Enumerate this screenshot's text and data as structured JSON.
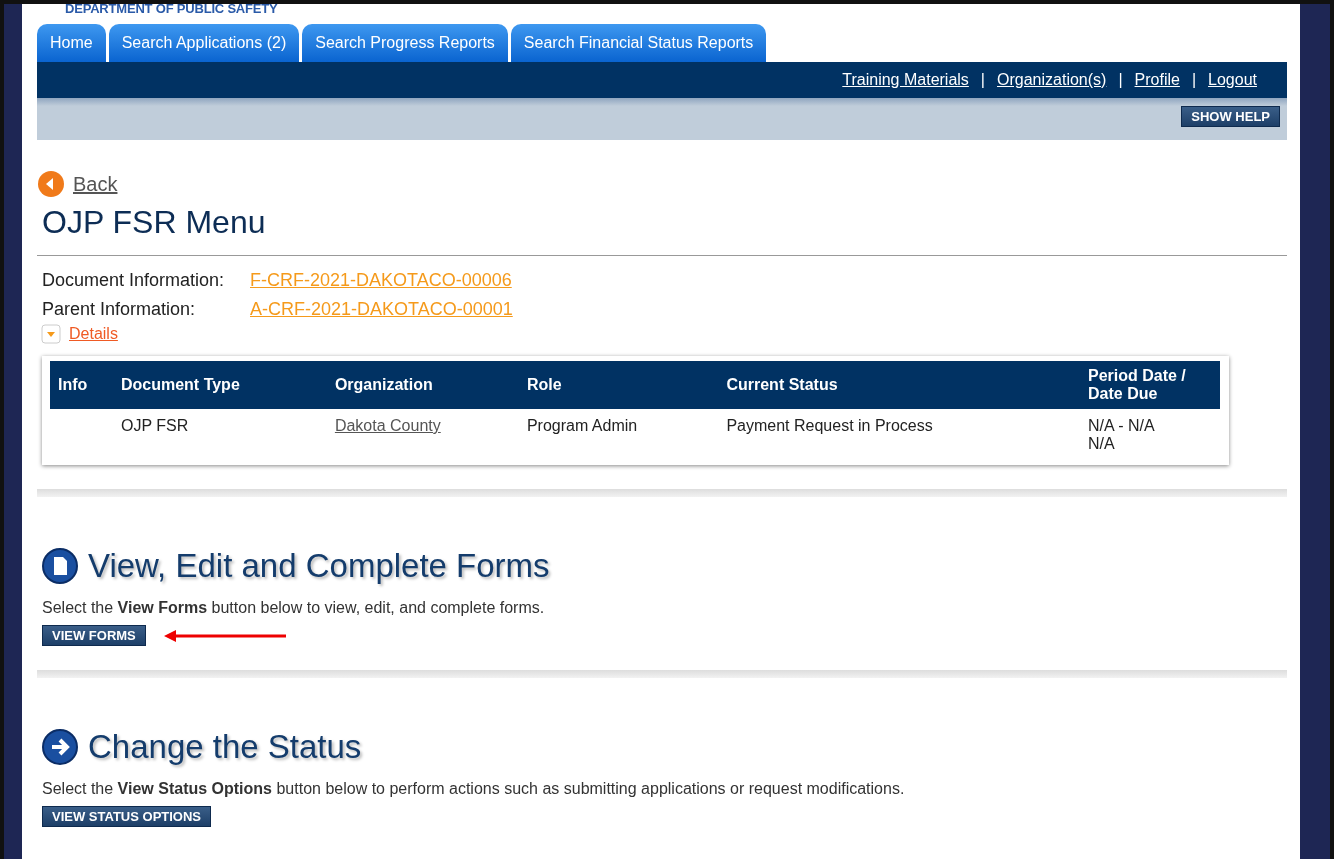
{
  "header": {
    "agency": "DEPARTMENT OF PUBLIC SAFETY"
  },
  "tabs": [
    {
      "label": "Home"
    },
    {
      "label": "Search Applications (2)"
    },
    {
      "label": "Search Progress Reports"
    },
    {
      "label": "Search Financial Status Reports"
    }
  ],
  "top_links": [
    "Training Materials",
    "Organization(s)",
    "Profile",
    "Logout"
  ],
  "link_separator": "|",
  "help_button": "SHOW HELP",
  "back": "Back",
  "page_title": "OJP FSR Menu",
  "info": [
    {
      "label": "Document Information:",
      "value": "F-CRF-2021-DAKOTACO-00006"
    },
    {
      "label": "Parent Information:",
      "value": "A-CRF-2021-DAKOTACO-00001"
    }
  ],
  "details_toggle": {
    "label": "Details",
    "expanded": false
  },
  "table": {
    "columns": [
      "Info",
      "Document Type",
      "Organization",
      "Role",
      "Current Status",
      "Period Date / Date Due"
    ],
    "rows": [
      {
        "cells": [
          "",
          "OJP FSR",
          "Dakota County",
          "Program Admin",
          "Payment Request in Process",
          "N/A - N/A\nN/A"
        ]
      }
    ]
  },
  "sections": [
    {
      "kind": "forms",
      "title": "View, Edit and Complete Forms",
      "text": "Select the **View Forms** button below to view, edit, and complete forms.",
      "button": "VIEW FORMS",
      "annotated": true
    },
    {
      "kind": "status",
      "title": "Change the Status",
      "text": "Select the **View Status Options** button below to perform actions such as submitting applications or request modifications.",
      "button": "VIEW STATUS OPTIONS",
      "annotated": false
    }
  ]
}
